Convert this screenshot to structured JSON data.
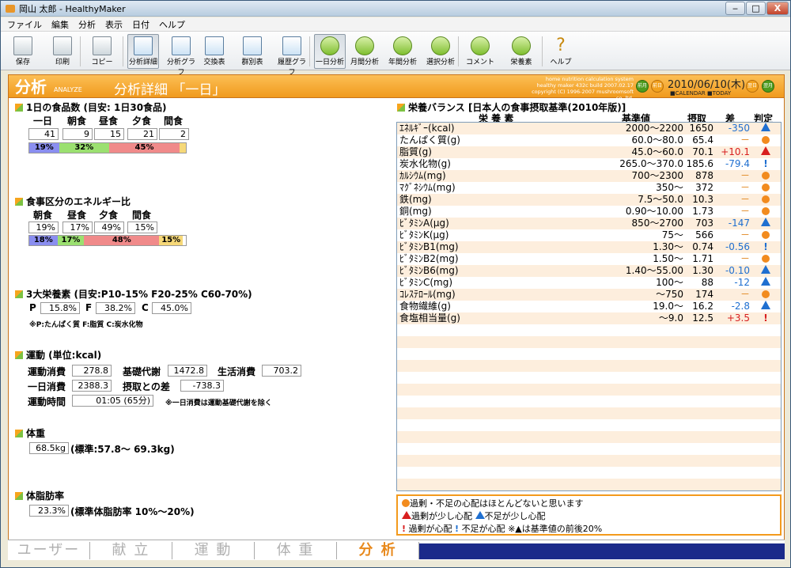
{
  "window": {
    "title": "岡山 太郎 - HealthyMaker",
    "min": "‒",
    "max": "□",
    "close": "X"
  },
  "menu": [
    "ファイル",
    "編集",
    "分析",
    "表示",
    "日付",
    "ヘルプ"
  ],
  "toolbar": [
    {
      "label": "保存",
      "icon": "save-icon"
    },
    {
      "label": "印刷",
      "icon": "print-icon"
    },
    {
      "label": "コピー",
      "icon": "copy-icon"
    },
    {
      "label": "分析詳細",
      "icon": "detail-icon",
      "on": true
    },
    {
      "label": "分析グラフ",
      "icon": "graph-icon"
    },
    {
      "label": "交換表",
      "icon": "exchange-icon"
    },
    {
      "label": "群別表",
      "icon": "group-icon"
    },
    {
      "label": "履歴グラフ",
      "icon": "history-icon"
    },
    {
      "label": "一日分析",
      "icon": "day-icon",
      "on": true
    },
    {
      "label": "月間分析",
      "icon": "month-icon"
    },
    {
      "label": "年間分析",
      "icon": "year-icon"
    },
    {
      "label": "選択分析",
      "icon": "select-icon"
    },
    {
      "label": "コメント",
      "icon": "comment-icon"
    },
    {
      "label": "栄養素",
      "icon": "nutrient-icon"
    },
    {
      "label": "ヘルプ",
      "icon": "help-icon"
    }
  ],
  "header": {
    "big": "分析",
    "sub": "ANALYZE",
    "title": "分析詳細 「一日」",
    "info1": "home nutrition calculation system",
    "info2": "healthy maker 432c build 2007.02.17",
    "info3": "copyright (C) 1996-2007 mushroomsoft co.,ltd.",
    "prev_month": "前月",
    "prev_day": "前日",
    "date": "2010/06/10(木)",
    "calendar": "CALENDAR",
    "today": "TODAY",
    "next_day": "翌日",
    "next_month": "翌月"
  },
  "food_count": {
    "title": "1日の食品数 (目安: 1日30食品)",
    "labels": [
      "一日",
      "朝食",
      "昼食",
      "夕食",
      "間食"
    ],
    "values": [
      "41",
      "9",
      "15",
      "21",
      "2"
    ],
    "bar": [
      {
        "t": "19%",
        "p": 19,
        "c": "#8a8ef0"
      },
      {
        "t": "32%",
        "p": 32,
        "c": "#9be070"
      },
      {
        "t": "45%",
        "p": 45,
        "c": "#f08a8a"
      },
      {
        "t": "",
        "p": 4,
        "c": "#f6d878"
      }
    ]
  },
  "energy_ratio": {
    "title": "食事区分のエネルギー比",
    "labels": [
      "朝食",
      "昼食",
      "夕食",
      "間食"
    ],
    "values": [
      "19%",
      "17%",
      "49%",
      "15%"
    ],
    "bar": [
      {
        "t": "18%",
        "p": 18,
        "c": "#8a8ef0"
      },
      {
        "t": "17%",
        "p": 17,
        "c": "#9be070"
      },
      {
        "t": "48%",
        "p": 48,
        "c": "#f08a8a"
      },
      {
        "t": "15%",
        "p": 15,
        "c": "#f6d878"
      }
    ]
  },
  "pfc": {
    "title": "3大栄養素 (目安:P10-15% F20-25% C60-70%)",
    "p_label": "P",
    "p": "15.8%",
    "f_label": "F",
    "f": "38.2%",
    "c_label": "C",
    "c": "45.0%",
    "note": "※P:たんぱく質 F:脂質 C:炭水化物"
  },
  "exercise": {
    "title": "運動 (単位:kcal)",
    "l1": "運動消費",
    "v1": "278.8",
    "l2": "基礎代謝",
    "v2": "1472.8",
    "l3": "生活消費",
    "v3": "703.2",
    "l4": "一日消費",
    "v4": "2388.3",
    "l5": "摂取との差",
    "v5": "-738.3",
    "l6": "運動時間",
    "v6": "01:05 (65分)",
    "note": "※一日消費は運動基礎代謝を除く"
  },
  "weight": {
    "title": "体重",
    "value": "68.5kg",
    "std": "(標準:57.8～ 69.3kg)"
  },
  "bodyfat": {
    "title": "体脂肪率",
    "value": "23.3%",
    "std": "(標準体脂肪率 10%～20%)"
  },
  "balance": {
    "title": "栄養バランス [日本人の食事摂取基準(2010年版)]",
    "headers": [
      "栄 養 素",
      "基準値",
      "摂取",
      "差",
      "判定"
    ],
    "rows": [
      {
        "n": "ｴﾈﾙｷﾞｰ(kcal)",
        "s": "2000～2200",
        "v": "1650",
        "d": "-350",
        "dc": "#1f6fd0",
        "j": "tri-blue"
      },
      {
        "n": "たんぱく質(g)",
        "s": "60.0～80.0",
        "v": "65.4",
        "d": "－",
        "dc": "#e07f10",
        "j": "dot"
      },
      {
        "n": "脂質(g)",
        "s": "45.0～60.0",
        "v": "70.1",
        "d": "+10.1",
        "dc": "#d81f1f",
        "j": "tri-red"
      },
      {
        "n": "炭水化物(g)",
        "s": "265.0～370.0",
        "v": "185.6",
        "d": "-79.4",
        "dc": "#1f6fd0",
        "j": "ex-blue"
      },
      {
        "n": "ｶﾙｼｳﾑ(mg)",
        "s": "700～2300",
        "v": "878",
        "d": "－",
        "dc": "#e07f10",
        "j": "dot"
      },
      {
        "n": "ﾏｸﾞﾈｼｳﾑ(mg)",
        "s": "350～",
        "v": "372",
        "d": "－",
        "dc": "#e07f10",
        "j": "dot"
      },
      {
        "n": "鉄(mg)",
        "s": "7.5～50.0",
        "v": "10.3",
        "d": "－",
        "dc": "#e07f10",
        "j": "dot"
      },
      {
        "n": "銅(mg)",
        "s": "0.90～10.00",
        "v": "1.73",
        "d": "－",
        "dc": "#e07f10",
        "j": "dot"
      },
      {
        "n": "ﾋﾞﾀﾐﾝA(μg)",
        "s": "850～2700",
        "v": "703",
        "d": "-147",
        "dc": "#1f6fd0",
        "j": "tri-blue"
      },
      {
        "n": "ﾋﾞﾀﾐﾝK(μg)",
        "s": "75～",
        "v": "566",
        "d": "－",
        "dc": "#e07f10",
        "j": "dot"
      },
      {
        "n": "ﾋﾞﾀﾐﾝB1(mg)",
        "s": "1.30～",
        "v": "0.74",
        "d": "-0.56",
        "dc": "#1f6fd0",
        "j": "ex-blue"
      },
      {
        "n": "ﾋﾞﾀﾐﾝB2(mg)",
        "s": "1.50～",
        "v": "1.71",
        "d": "－",
        "dc": "#e07f10",
        "j": "dot"
      },
      {
        "n": "ﾋﾞﾀﾐﾝB6(mg)",
        "s": "1.40～55.00",
        "v": "1.30",
        "d": "-0.10",
        "dc": "#1f6fd0",
        "j": "tri-blue"
      },
      {
        "n": "ﾋﾞﾀﾐﾝC(mg)",
        "s": "100～",
        "v": "88",
        "d": "-12",
        "dc": "#1f6fd0",
        "j": "tri-blue"
      },
      {
        "n": "ｺﾚｽﾃﾛｰﾙ(mg)",
        "s": "～750",
        "v": "174",
        "d": "－",
        "dc": "#e07f10",
        "j": "dot"
      },
      {
        "n": "食物繊維(g)",
        "s": "19.0～",
        "v": "16.2",
        "d": "-2.8",
        "dc": "#1f6fd0",
        "j": "tri-blue"
      },
      {
        "n": "食塩相当量(g)",
        "s": "～9.0",
        "v": "12.5",
        "d": "+3.5",
        "dc": "#d81f1f",
        "j": "ex-red"
      }
    ]
  },
  "legend": {
    "l1": "過剰・不足の心配はほとんどないと思います",
    "l2a": "過剰が少し心配",
    "l2b": "不足が少し心配",
    "l3a": "過剰が心配",
    "l3b": "不足が心配",
    "l3c": "※▲は基準値の前後20%"
  },
  "tabs": [
    "ユーザー",
    "献 立",
    "運 動",
    "体 重",
    "分 析"
  ]
}
